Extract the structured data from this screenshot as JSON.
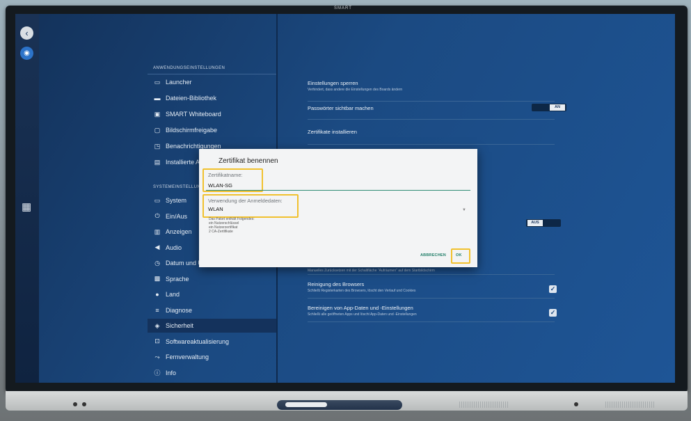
{
  "device": {
    "brand": "SMART"
  },
  "menu": {
    "app_section_title": "ANWENDUNGSEINSTELLUNGEN",
    "app_items": [
      {
        "label": "Launcher",
        "icon": "window-icon"
      },
      {
        "label": "Dateien-Bibliothek",
        "icon": "folder-icon"
      },
      {
        "label": "SMART Whiteboard",
        "icon": "whiteboard-icon"
      },
      {
        "label": "Bildschirmfreigabe",
        "icon": "screen-share-icon"
      },
      {
        "label": "Benachrichtigungen",
        "icon": "notification-icon"
      },
      {
        "label": "Installierte Apps",
        "icon": "apps-icon"
      }
    ],
    "system_section_title": "SYSTEMEINSTELLUNGEN",
    "system_items": [
      {
        "label": "System",
        "icon": "monitor-icon"
      },
      {
        "label": "Ein/Aus",
        "icon": "power-icon"
      },
      {
        "label": "Anzeigen",
        "icon": "display-icon"
      },
      {
        "label": "Audio",
        "icon": "speaker-icon"
      },
      {
        "label": "Datum und Uhrzeit",
        "icon": "clock-icon"
      },
      {
        "label": "Sprache",
        "icon": "language-icon"
      },
      {
        "label": "Land",
        "icon": "location-icon"
      },
      {
        "label": "Diagnose",
        "icon": "list-icon"
      },
      {
        "label": "Sicherheit",
        "icon": "shield-icon",
        "active": true
      },
      {
        "label": "Softwareaktualisierung",
        "icon": "update-icon"
      },
      {
        "label": "Fernverwaltung",
        "icon": "remote-icon"
      },
      {
        "label": "Info",
        "icon": "info-icon"
      }
    ]
  },
  "settings": {
    "lock_title": "Einstellungen sperren",
    "lock_sub": "Verhindert, dass andere die Einstellungen des Boards ändern",
    "passwords_title": "Passwörter sichtbar machen",
    "passwords_toggle": "AN",
    "certs_title": "Zertifikate installieren",
    "aus_toggle": "AUS",
    "reset_sub": "Manuelles Zurücksetzen mit der Schaltfläche \"Aufräumen\" auf dem Startbildschirm",
    "browser_title": "Reinigung des Browsers",
    "browser_sub": "Schließt Registerkarten des Browsers, löscht den Verlauf und Cookies",
    "appdata_title": "Bereinigen von App-Daten und -Einstellungen",
    "appdata_sub": "Schließt alle geöffneten Apps und löscht App-Daten und -Einstellungen"
  },
  "dialog": {
    "title": "Zertifikat benennen",
    "name_label": "Zertifikatname:",
    "name_value": "WLAN-SG",
    "usage_label": "Verwendung der Anmeldedaten:",
    "usage_value": "WLAN",
    "package_line1": "Das Paket enthält Folgendes:",
    "package_line2": "ein Nutzerschlüssel",
    "package_line3": "ein Nutzerzertifikat",
    "package_line4": "2 CA-Zertifikate",
    "cancel_label": "ABBRECHEN",
    "ok_label": "OK",
    "highlight_color": "#f1c12e",
    "accent_color": "#2e8b74"
  }
}
